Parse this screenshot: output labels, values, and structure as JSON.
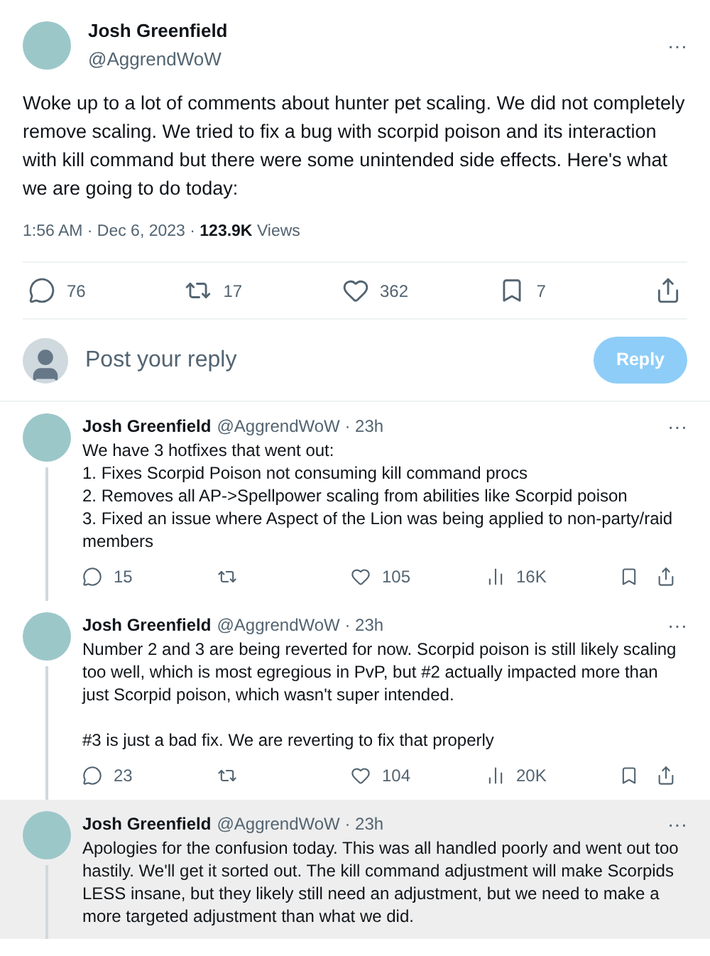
{
  "tweet": {
    "name": "Josh Greenfield",
    "handle": "@AggrendWoW",
    "more": "···",
    "text": "Woke up to a lot of comments about hunter pet scaling. We did not completely remove scaling. We tried to fix a bug with scorpid poison and its interaction with kill command but there were some unintended side effects. Here's what we are going to do today:",
    "time": "1:56 AM · Dec 6, 2023 · ",
    "views_count": "123.9K",
    "views_label": "Views",
    "actions": [
      {
        "kind": "reply",
        "count": "76"
      },
      {
        "kind": "repost",
        "count": "17"
      },
      {
        "kind": "like",
        "count": "362"
      },
      {
        "kind": "bookmark",
        "count": "7"
      },
      {
        "kind": "share"
      }
    ]
  },
  "composer": {
    "placeholder": "Post your reply",
    "button": "Reply",
    "disabled": true
  },
  "replies": [
    {
      "name": "Josh Greenfield",
      "handle": "@AggrendWoW · 23h",
      "more": "···",
      "highlighted": false,
      "text": "We have 3 hotfixes that went out:\n1. Fixes Scorpid Poison not consuming kill command procs\n2. Removes all AP->Spellpower scaling from abilities like Scorpid poison\n3. Fixed an issue where Aspect of the Lion was being applied to non-party/raid members",
      "actions": [
        {
          "kind": "reply",
          "count": "15"
        },
        {
          "kind": "repost"
        },
        {
          "kind": "like",
          "count": "105"
        },
        {
          "kind": "views",
          "count": "16K"
        },
        {
          "kind": "bookmark"
        },
        {
          "kind": "share"
        }
      ]
    },
    {
      "name": "Josh Greenfield",
      "handle": "@AggrendWoW · 23h",
      "more": "···",
      "highlighted": false,
      "text": "Number 2 and 3 are being reverted for now. Scorpid poison is still likely scaling too well, which is most egregious in PvP, but #2 actually impacted more than just Scorpid poison, which wasn't super intended.\n\n#3 is just a bad fix. We are reverting to fix that properly",
      "actions": [
        {
          "kind": "reply",
          "count": "23"
        },
        {
          "kind": "repost"
        },
        {
          "kind": "like",
          "count": "104"
        },
        {
          "kind": "views",
          "count": "20K"
        },
        {
          "kind": "bookmark"
        },
        {
          "kind": "share"
        }
      ]
    },
    {
      "name": "Josh Greenfield",
      "handle": "@AggrendWoW · 23h",
      "more": "···",
      "highlighted": true,
      "text": "Apologies for the confusion today. This was all handled poorly and went out too hastily. We'll get it sorted out. The kill command adjustment will make Scorpids LESS insane, but they likely still need an adjustment, but we need to make a more targeted adjustment than what we did."
    }
  ]
}
